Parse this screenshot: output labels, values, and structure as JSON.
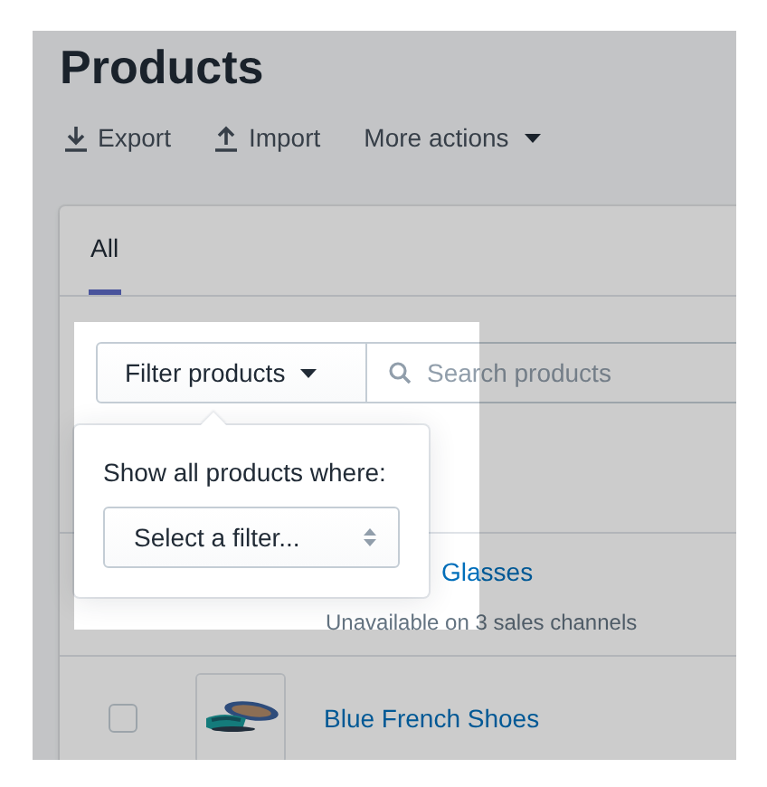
{
  "page": {
    "title": "Products"
  },
  "actions": [
    {
      "kind": "export",
      "label": "Export"
    },
    {
      "kind": "import",
      "label": "Import"
    },
    {
      "kind": "menu",
      "label": "More actions"
    }
  ],
  "tabs": [
    {
      "label": "All",
      "selected": true
    }
  ],
  "filter": {
    "button": "Filter products",
    "search_placeholder": "Search products"
  },
  "popover": {
    "prompt": "Show all products where:",
    "select": "Select a filter..."
  },
  "products": [
    {
      "name": "Glasses",
      "subtitle": "Unavailable on 3 sales channels"
    },
    {
      "name": "Blue French Shoes",
      "checked": false
    }
  ]
}
